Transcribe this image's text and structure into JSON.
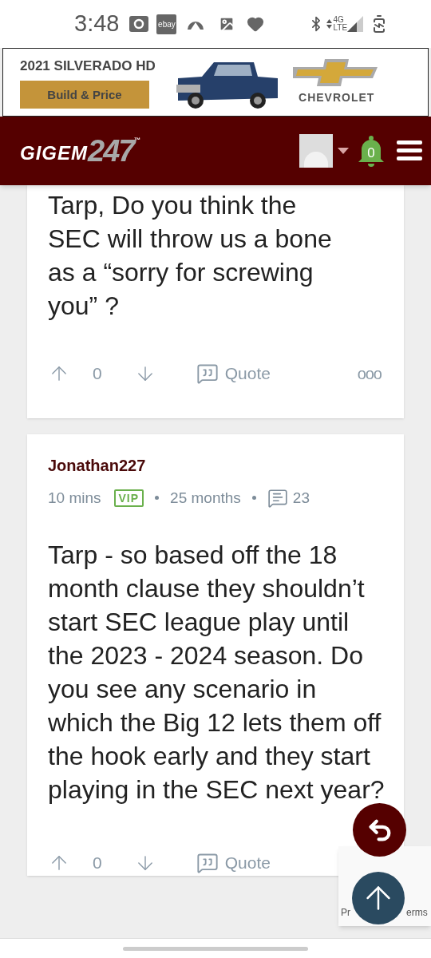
{
  "status_bar": {
    "time": "3:48",
    "notification_label": "ebay",
    "network_top": "4G",
    "network_bottom": "LTE"
  },
  "ad": {
    "headline": "2021 SILVERADO HD",
    "button": "Build & Price",
    "brand": "CHEVROLET"
  },
  "header": {
    "logo_word": "GIGEM",
    "logo_number": "247",
    "logo_mark": "™",
    "notification_count": "0"
  },
  "posts": [
    {
      "text": "Tarp, Do you think the SEC will throw us a bone as a “sorry for screwing you” ?",
      "votes": "0",
      "quote": "Quote",
      "more": "ooo"
    },
    {
      "author": "Jonathan227",
      "time": "10 mins",
      "badge": "VIP",
      "tenure": "25 months",
      "post_count": "23",
      "text": "Tarp - so based off the 18 month clause they shouldn’t start SEC league play until the 2023 - 2024 season. Do you see any scenario in which the Big 12 lets them off the hook early and they start playing in the SEC next year?",
      "votes": "0",
      "quote": "Quote"
    }
  ],
  "recaptcha": {
    "left_text": "Pr",
    "right_text": "erms"
  }
}
